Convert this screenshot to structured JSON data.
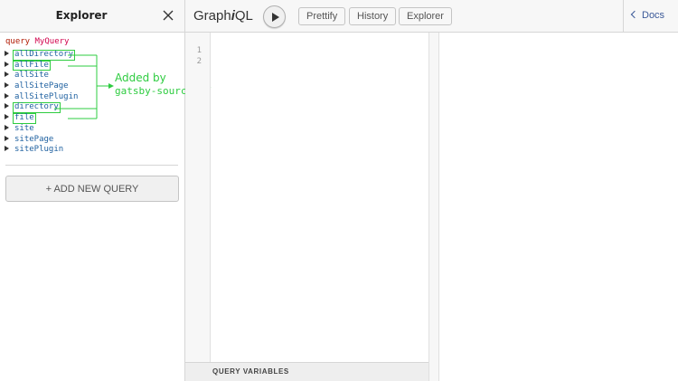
{
  "explorer": {
    "title": "Explorer",
    "query_keyword": "query",
    "query_name": "MyQuery",
    "fields": [
      {
        "label": "allDirectory",
        "highlighted": true
      },
      {
        "label": "allFile",
        "highlighted": true
      },
      {
        "label": "allSite",
        "highlighted": false
      },
      {
        "label": "allSitePage",
        "highlighted": false
      },
      {
        "label": "allSitePlugin",
        "highlighted": false
      },
      {
        "label": "directory",
        "highlighted": true
      },
      {
        "label": "file",
        "highlighted": true
      },
      {
        "label": "site",
        "highlighted": false
      },
      {
        "label": "sitePage",
        "highlighted": false
      },
      {
        "label": "sitePlugin",
        "highlighted": false
      }
    ],
    "add_query_label": "+ ADD NEW QUERY"
  },
  "annotation": {
    "title": "Added by",
    "detail": "gatsby-source-filesystem",
    "color": "#2ecc40"
  },
  "toolbar": {
    "title_prefix": "Graph",
    "title_em": "i",
    "title_suffix": "QL",
    "prettify_label": "Prettify",
    "history_label": "History",
    "explorer_label": "Explorer",
    "docs_label": "Docs"
  },
  "editor": {
    "line_numbers": [
      "1",
      "2"
    ],
    "variables_label": "QUERY VARIABLES"
  },
  "colors": {
    "field": "#1f61a0",
    "query_keyword": "#b11a04",
    "query_name": "#d2054e",
    "docs_link": "#3b5998"
  },
  "icons": {
    "close": "close-icon",
    "run": "play-icon",
    "docs": "chevron-left-icon",
    "expand": "caret-right-icon"
  }
}
